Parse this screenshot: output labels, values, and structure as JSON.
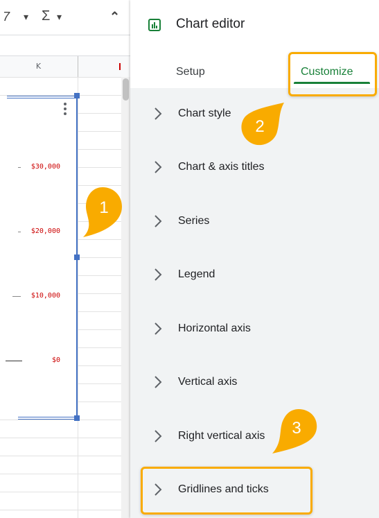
{
  "sheet": {
    "toolbar": {
      "font_fragment": "7",
      "dropdown_glyph": "▾",
      "sum_glyph": "Σ",
      "collapse_glyph": "⌃"
    },
    "column_header": "K",
    "axis_labels": [
      "$30,000",
      "$20,000",
      "$10,000",
      "$0"
    ]
  },
  "editor": {
    "title": "Chart editor",
    "tabs": {
      "setup": "Setup",
      "customize": "Customize",
      "active": "Customize"
    },
    "sections": [
      "Chart style",
      "Chart & axis titles",
      "Series",
      "Legend",
      "Horizontal axis",
      "Vertical axis",
      "Right vertical axis",
      "Gridlines and ticks"
    ]
  },
  "callouts": [
    "1",
    "2",
    "3"
  ],
  "colors": {
    "accent_green": "#188038",
    "highlight_orange": "#f9ab00",
    "selection_blue": "#4472c4",
    "axis_label_red": "#cc0000"
  }
}
